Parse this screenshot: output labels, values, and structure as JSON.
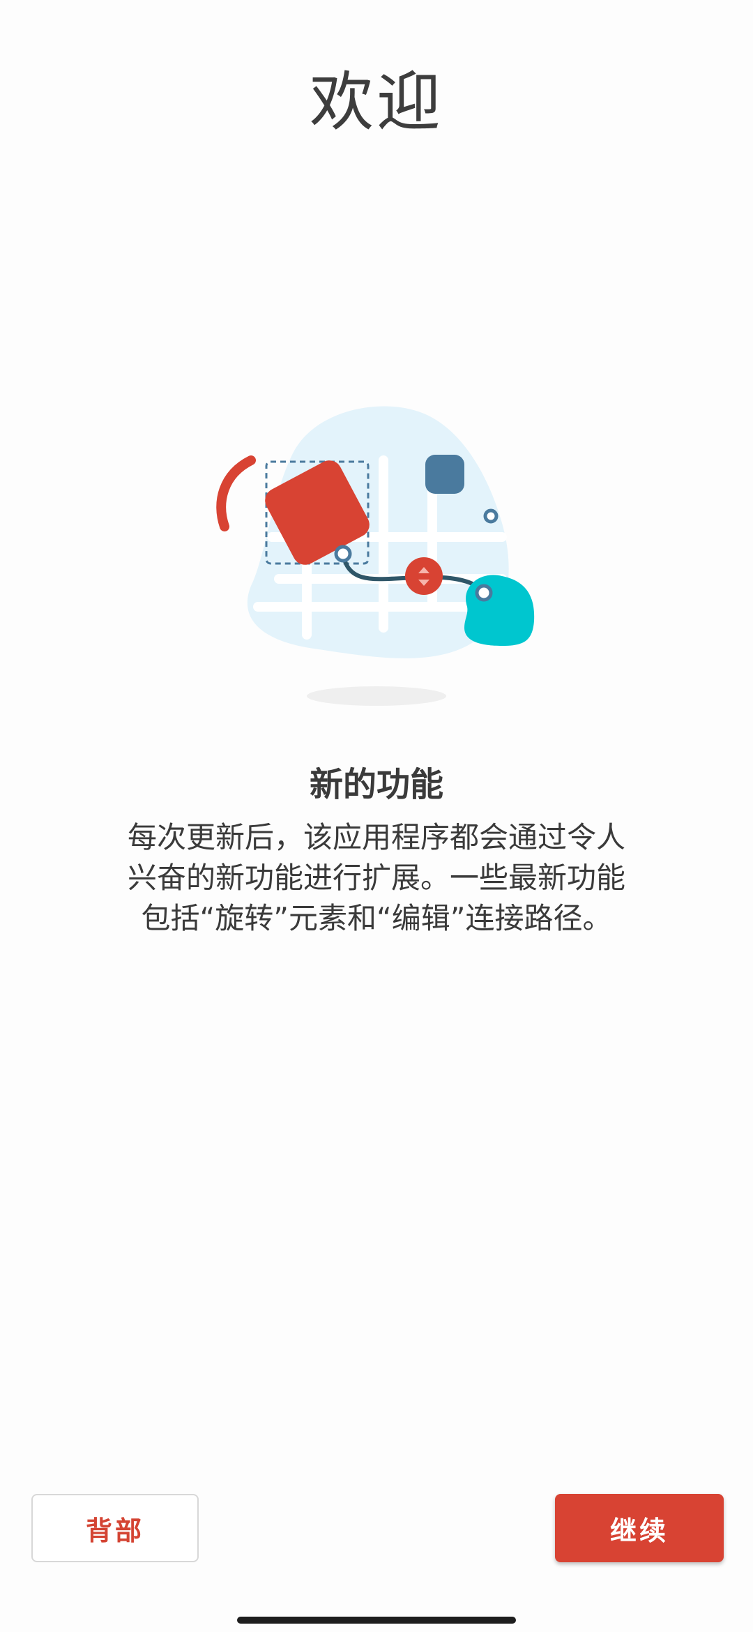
{
  "header": {
    "title": "欢迎"
  },
  "feature": {
    "title": "新的功能",
    "description": "每次更新后，该应用程序都会通过令人兴奋的新功能进行扩展。一些最新功能包括“旋转”元素和“编辑”连接路径。"
  },
  "buttons": {
    "back_label": "背部",
    "continue_label": "继续"
  },
  "colors": {
    "accent": "#d84333",
    "teal": "#00c6cf",
    "slate_blue": "#4a7a9e",
    "light_blue_bg": "#e3f3fb"
  },
  "illustration": {
    "icons": [
      "rotate-arc-icon",
      "red-rounded-square-icon",
      "connection-path-icon",
      "teal-blob-icon",
      "blue-square-icon"
    ]
  }
}
